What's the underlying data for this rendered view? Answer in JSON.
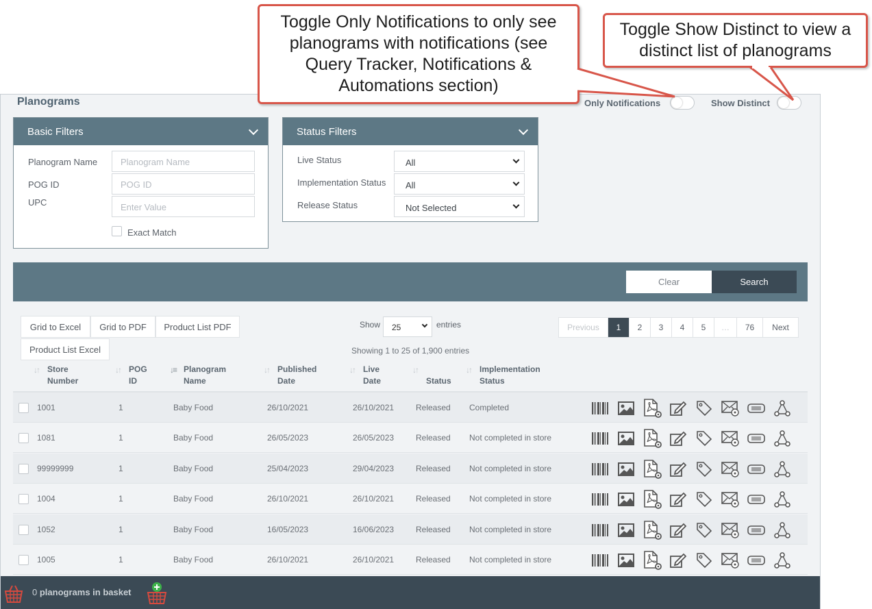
{
  "page": {
    "title": "Planograms"
  },
  "toggles": {
    "only_notifications": "Only Notifications",
    "show_distinct": "Show Distinct"
  },
  "callouts": {
    "notifications": "Toggle Only Notifications to only see planograms with notifications (see Query Tracker, Notifications & Automations section)",
    "distinct": "Toggle Show Distinct to view a distinct list of planograms"
  },
  "basic_filters": {
    "title": "Basic Filters",
    "planogram_name": {
      "label": "Planogram Name",
      "placeholder": "Planogram Name"
    },
    "pog_id": {
      "label": "POG ID",
      "placeholder": "POG ID"
    },
    "upc": {
      "label": "UPC",
      "placeholder": "Enter Value"
    },
    "exact_match": "Exact Match"
  },
  "status_filters": {
    "title": "Status Filters",
    "live_status": {
      "label": "Live Status",
      "value": "All"
    },
    "implementation_status": {
      "label": "Implementation Status",
      "value": "All"
    },
    "release_status": {
      "label": "Release Status",
      "value": "Not Selected"
    }
  },
  "actions": {
    "clear": "Clear",
    "search": "Search"
  },
  "exports": [
    "Grid to Excel",
    "Grid to PDF",
    "Product List PDF",
    "Product List Excel"
  ],
  "length": {
    "show": "Show",
    "value": "25",
    "entries": "entries"
  },
  "info": "Showing 1 to 25 of 1,900 entries",
  "pagination": [
    "Previous",
    "1",
    "2",
    "3",
    "4",
    "5",
    "…",
    "76",
    "Next"
  ],
  "pagination_active": "1",
  "columns": {
    "store_number": [
      "Store",
      "Number"
    ],
    "pog_id": [
      "POG",
      "ID"
    ],
    "planogram_name": [
      "Planogram",
      "Name"
    ],
    "published_date": [
      "Published",
      "Date"
    ],
    "live_date": [
      "Live",
      "Date"
    ],
    "status": [
      "",
      "Status"
    ],
    "implementation_status": [
      "Implementation",
      "Status"
    ]
  },
  "rows": [
    {
      "store": "1001",
      "pog": "1",
      "name": "Baby Food",
      "published": "26/10/2021",
      "live": "26/10/2021",
      "status": "Released",
      "impl": "Completed"
    },
    {
      "store": "1081",
      "pog": "1",
      "name": "Baby Food",
      "published": "26/05/2023",
      "live": "26/05/2023",
      "status": "Released",
      "impl": "Not completed in store"
    },
    {
      "store": "99999999",
      "pog": "1",
      "name": "Baby Food",
      "published": "25/04/2023",
      "live": "29/04/2023",
      "status": "Released",
      "impl": "Not completed in store"
    },
    {
      "store": "1004",
      "pog": "1",
      "name": "Baby Food",
      "published": "26/10/2021",
      "live": "26/10/2021",
      "status": "Released",
      "impl": "Not completed in store"
    },
    {
      "store": "1052",
      "pog": "1",
      "name": "Baby Food",
      "published": "16/05/2023",
      "live": "16/06/2023",
      "status": "Released",
      "impl": "Not completed in store"
    },
    {
      "store": "1005",
      "pog": "1",
      "name": "Baby Food",
      "published": "26/10/2021",
      "live": "26/10/2021",
      "status": "Released",
      "impl": "Not completed in store"
    }
  ],
  "row_icons": [
    "barcode-icon",
    "image-icon",
    "pdf-settings-icon",
    "edit-icon",
    "tag-icon",
    "email-icon",
    "ticket-icon",
    "network-icon"
  ],
  "basket": {
    "count": "0",
    "label": "planograms in basket"
  },
  "colors": {
    "header": "#5d7885",
    "dark": "#3b4a55",
    "callout_border": "#d8564a"
  }
}
